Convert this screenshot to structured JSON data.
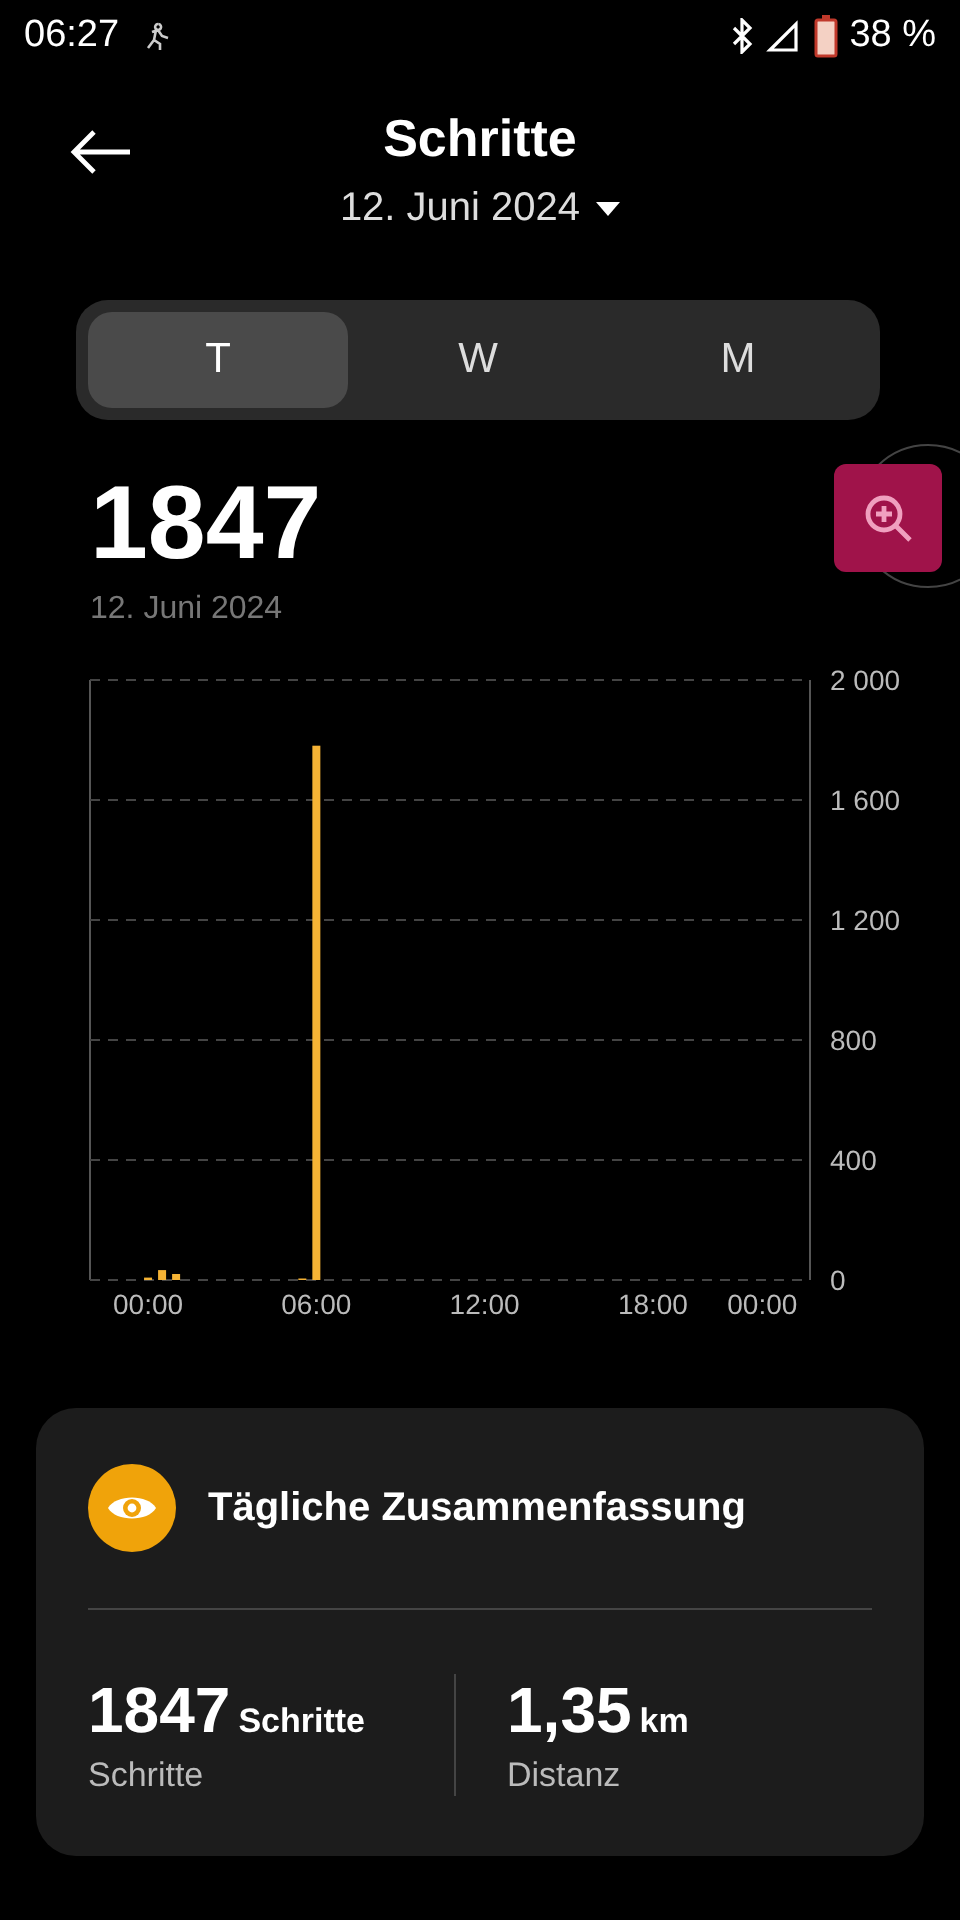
{
  "status_bar": {
    "time": "06:27",
    "battery": "38 %"
  },
  "header": {
    "title": "Schritte",
    "date": "12. Juni 2024"
  },
  "tabs": [
    {
      "label": "T",
      "selected": true
    },
    {
      "label": "W",
      "selected": false
    },
    {
      "label": "M",
      "selected": false
    }
  ],
  "total": {
    "value": "1847",
    "date": "12. Juni 2024"
  },
  "chart": {
    "chart_data": {
      "type": "bar",
      "x": [
        0,
        0.5,
        1,
        5.5,
        6
      ],
      "grid": true,
      "series": [
        {
          "color": "#f5b335",
          "values": [
            8,
            33,
            20,
            5,
            1781
          ]
        }
      ],
      "xlim": [
        -2.07,
        23.6
      ],
      "ylim": [
        0,
        2000
      ],
      "xticks": [
        {
          "value": 0,
          "label": "00:00"
        },
        {
          "value": 6,
          "label": "06:00"
        },
        {
          "value": 12,
          "label": "12:00"
        },
        {
          "value": 18,
          "label": "18:00"
        },
        {
          "value": 21.9,
          "label": "00:00"
        }
      ],
      "yticks": [
        {
          "value": 0,
          "label": "0"
        },
        {
          "value": 400,
          "label": "400"
        },
        {
          "value": 800,
          "label": "800"
        },
        {
          "value": 1200,
          "label": "1 200"
        },
        {
          "value": 1600,
          "label": "1 600"
        },
        {
          "value": 2000,
          "label": "2 000"
        }
      ]
    }
  },
  "summary": {
    "title": "Tägliche Zusammenfassung",
    "stats": [
      {
        "value": "1847",
        "unit": "Schritte",
        "label": "Schritte"
      },
      {
        "value": "1,35",
        "unit": "km",
        "label": "Distanz"
      }
    ]
  }
}
